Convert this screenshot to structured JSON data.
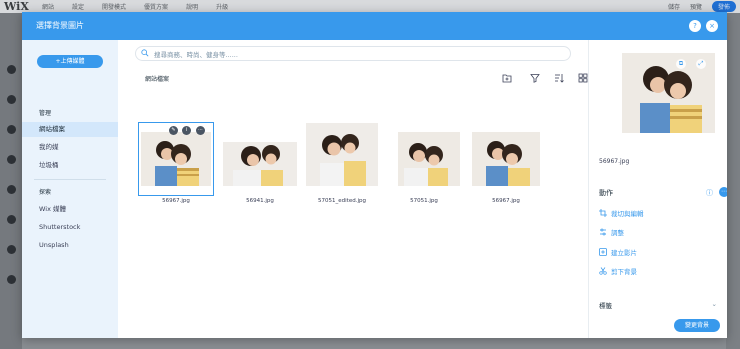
{
  "editor": {
    "logo": "WiX",
    "menu": [
      "網站",
      "設定",
      "開發模式",
      "優質方案",
      "說明",
      "升級"
    ],
    "right": [
      "儲存",
      "預覽",
      "發佈"
    ]
  },
  "modal": {
    "title": "選擇背景圖片",
    "help_label": "?",
    "close_label": "×"
  },
  "sidebar": {
    "upload_label": "+上傳媒體",
    "manage_title": "管理",
    "manage_items": [
      "網站檔案",
      "我的媒",
      "垃圾桶"
    ],
    "explore_title": "探索",
    "explore_items": [
      "Wix 媒體",
      "Shutterstock",
      "Unsplash"
    ]
  },
  "search": {
    "placeholder": "搜尋商務、時尚、健身等......"
  },
  "main": {
    "breadcrumb": "網站檔案",
    "files": [
      {
        "name": "56967.jpg",
        "selected": true
      },
      {
        "name": "56941.jpg",
        "selected": false
      },
      {
        "name": "57051_edited.jpg",
        "selected": false
      },
      {
        "name": "57051.jpg",
        "selected": false
      },
      {
        "name": "56967.jpg",
        "selected": false
      }
    ]
  },
  "info": {
    "file_name": "56967.jpg",
    "actions_title": "動作",
    "actions": [
      "裁切與編輯",
      "調整",
      "建立影片",
      "剪下背景"
    ],
    "label_title": "標籤",
    "label_chevron": "⌄",
    "change_button": "變更背景"
  },
  "colors": {
    "accent": "#3899ec",
    "sidebar_bg": "#eaf3fc",
    "active_item": "#d3e7fb"
  }
}
